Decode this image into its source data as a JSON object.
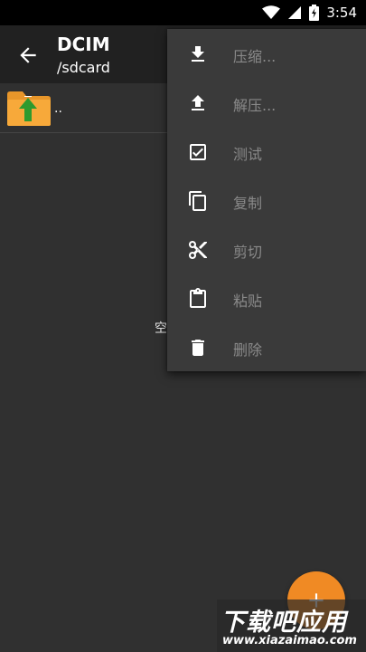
{
  "status_bar": {
    "time": "3:54",
    "icons": [
      "wifi-icon",
      "signal-icon",
      "battery-charging-icon"
    ]
  },
  "app_bar": {
    "title": "DCIM",
    "subtitle": "/sdcard",
    "back_icon": "arrow-back-icon"
  },
  "file_list": {
    "parent_label": "..",
    "parent_icon": "folder-up-icon",
    "empty_text": "空"
  },
  "menu": {
    "items": [
      {
        "label": "压缩...",
        "icon": "download-icon"
      },
      {
        "label": "解压...",
        "icon": "upload-icon"
      },
      {
        "label": "测试",
        "icon": "check-box-icon"
      },
      {
        "label": "复制",
        "icon": "copy-icon"
      },
      {
        "label": "剪切",
        "icon": "scissors-icon"
      },
      {
        "label": "粘贴",
        "icon": "clipboard-icon"
      },
      {
        "label": "删除",
        "icon": "trash-icon"
      }
    ]
  },
  "fab": {
    "icon": "plus-icon"
  },
  "watermark": {
    "main": "下载吧应用",
    "url": "www.xiazaimao.com"
  },
  "colors": {
    "background": "#303030",
    "app_bar": "#212121",
    "menu": "#3a3a3a",
    "menu_text": "#8a8a8a",
    "accent": "#f08a24"
  }
}
